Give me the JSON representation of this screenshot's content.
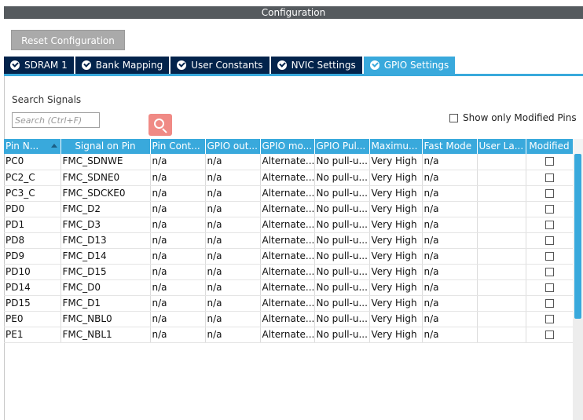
{
  "window": {
    "title": "Configuration"
  },
  "toolbar": {
    "reset_label": "Reset Configuration"
  },
  "tabs": [
    {
      "label": "SDRAM 1",
      "active": false
    },
    {
      "label": "Bank Mapping",
      "active": false
    },
    {
      "label": "User Constants",
      "active": false
    },
    {
      "label": "NVIC Settings",
      "active": false
    },
    {
      "label": "GPIO Settings",
      "active": true
    }
  ],
  "search": {
    "label": "Search Signals",
    "placeholder": "Search (Ctrl+F)"
  },
  "filter": {
    "modified_only_label": "Show only Modified Pins",
    "modified_only_checked": false
  },
  "table": {
    "columns": [
      "Pin N...",
      "Signal on Pin",
      "Pin Cont...",
      "GPIO out...",
      "GPIO mo...",
      "GPIO Pul...",
      "Maximu...",
      "Fast Mode",
      "User La...",
      "Modified"
    ],
    "rows": [
      {
        "pin": "PC0",
        "signal": "FMC_SDNWE",
        "pin_context": "n/a",
        "gpio_output": "n/a",
        "gpio_mode": "Alternate...",
        "gpio_pull": "No pull-u...",
        "max_speed": "Very High",
        "fast_mode": "n/a",
        "user_label": "",
        "modified": false
      },
      {
        "pin": "PC2_C",
        "signal": "FMC_SDNE0",
        "pin_context": "n/a",
        "gpio_output": "n/a",
        "gpio_mode": "Alternate...",
        "gpio_pull": "No pull-u...",
        "max_speed": "Very High",
        "fast_mode": "n/a",
        "user_label": "",
        "modified": false
      },
      {
        "pin": "PC3_C",
        "signal": "FMC_SDCKE0",
        "pin_context": "n/a",
        "gpio_output": "n/a",
        "gpio_mode": "Alternate...",
        "gpio_pull": "No pull-u...",
        "max_speed": "Very High",
        "fast_mode": "n/a",
        "user_label": "",
        "modified": false
      },
      {
        "pin": "PD0",
        "signal": "FMC_D2",
        "pin_context": "n/a",
        "gpio_output": "n/a",
        "gpio_mode": "Alternate...",
        "gpio_pull": "No pull-u...",
        "max_speed": "Very High",
        "fast_mode": "n/a",
        "user_label": "",
        "modified": false
      },
      {
        "pin": "PD1",
        "signal": "FMC_D3",
        "pin_context": "n/a",
        "gpio_output": "n/a",
        "gpio_mode": "Alternate...",
        "gpio_pull": "No pull-u...",
        "max_speed": "Very High",
        "fast_mode": "n/a",
        "user_label": "",
        "modified": false
      },
      {
        "pin": "PD8",
        "signal": "FMC_D13",
        "pin_context": "n/a",
        "gpio_output": "n/a",
        "gpio_mode": "Alternate...",
        "gpio_pull": "No pull-u...",
        "max_speed": "Very High",
        "fast_mode": "n/a",
        "user_label": "",
        "modified": false
      },
      {
        "pin": "PD9",
        "signal": "FMC_D14",
        "pin_context": "n/a",
        "gpio_output": "n/a",
        "gpio_mode": "Alternate...",
        "gpio_pull": "No pull-u...",
        "max_speed": "Very High",
        "fast_mode": "n/a",
        "user_label": "",
        "modified": false
      },
      {
        "pin": "PD10",
        "signal": "FMC_D15",
        "pin_context": "n/a",
        "gpio_output": "n/a",
        "gpio_mode": "Alternate...",
        "gpio_pull": "No pull-u...",
        "max_speed": "Very High",
        "fast_mode": "n/a",
        "user_label": "",
        "modified": false
      },
      {
        "pin": "PD14",
        "signal": "FMC_D0",
        "pin_context": "n/a",
        "gpio_output": "n/a",
        "gpio_mode": "Alternate...",
        "gpio_pull": "No pull-u...",
        "max_speed": "Very High",
        "fast_mode": "n/a",
        "user_label": "",
        "modified": false
      },
      {
        "pin": "PD15",
        "signal": "FMC_D1",
        "pin_context": "n/a",
        "gpio_output": "n/a",
        "gpio_mode": "Alternate...",
        "gpio_pull": "No pull-u...",
        "max_speed": "Very High",
        "fast_mode": "n/a",
        "user_label": "",
        "modified": false
      },
      {
        "pin": "PE0",
        "signal": "FMC_NBL0",
        "pin_context": "n/a",
        "gpio_output": "n/a",
        "gpio_mode": "Alternate...",
        "gpio_pull": "No pull-u...",
        "max_speed": "Very High",
        "fast_mode": "n/a",
        "user_label": "",
        "modified": false
      },
      {
        "pin": "PE1",
        "signal": "FMC_NBL1",
        "pin_context": "n/a",
        "gpio_output": "n/a",
        "gpio_mode": "Alternate...",
        "gpio_pull": "No pull-u...",
        "max_speed": "Very High",
        "fast_mode": "n/a",
        "user_label": "",
        "modified": false
      }
    ]
  },
  "icons": {
    "search": "search-icon",
    "tab_check": "check-circle-icon",
    "sort": "sort-ascending-icon"
  },
  "colors": {
    "accent": "#39a9dc",
    "tab_dark": "#03234b",
    "title_bar": "#555a5e",
    "search_button": "#f08a85",
    "reset_button": "#aaaaaa"
  }
}
